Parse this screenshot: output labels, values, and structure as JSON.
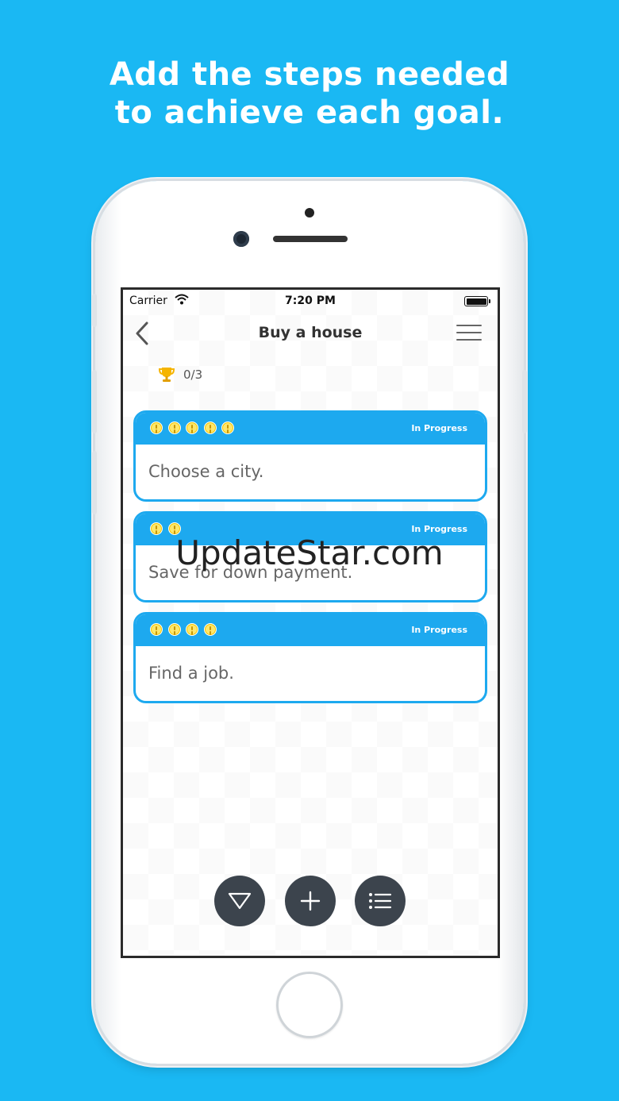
{
  "headline": {
    "line1": "Add the steps needed",
    "line2": "to achieve each goal."
  },
  "status_bar": {
    "carrier": "Carrier",
    "time": "7:20 PM"
  },
  "nav": {
    "title": "Buy a house"
  },
  "progress": {
    "count": "0/3"
  },
  "steps": [
    {
      "text": "Choose a city.",
      "status": "In Progress",
      "priority": 5
    },
    {
      "text": "Save for down payment.",
      "status": "In Progress",
      "priority": 2
    },
    {
      "text": "Find a job.",
      "status": "In Progress",
      "priority": 4
    }
  ],
  "watermark": "UpdateStar.com",
  "colors": {
    "background": "#1ab8f3",
    "card_accent": "#1da9ef",
    "fab": "#3c444d",
    "priority_dot": "#ffe76a"
  },
  "icons": [
    "wifi-icon",
    "battery-icon",
    "back-chevron-icon",
    "menu-icon",
    "trophy-icon",
    "priority-icon",
    "filter-icon",
    "plus-icon",
    "list-icon"
  ]
}
